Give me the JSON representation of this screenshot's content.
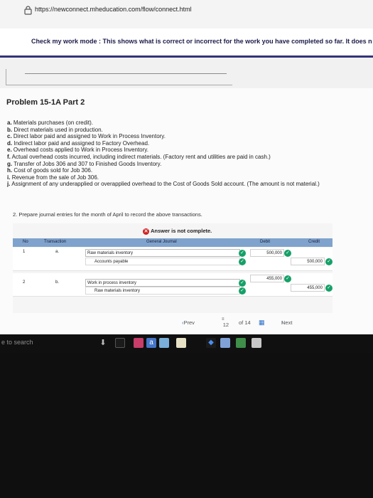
{
  "browser": {
    "url": "https://newconnect.mheducation.com/flow/connect.html"
  },
  "banner": {
    "message": "Check my work mode : This shows what is correct or incorrect for the work you have completed so far. It does n"
  },
  "problem": {
    "title": "Problem 15-1A Part 2",
    "items": [
      {
        "letter": "a.",
        "text": "Materials purchases (on credit)."
      },
      {
        "letter": "b.",
        "text": "Direct materials used in production."
      },
      {
        "letter": "c.",
        "text": "Direct labor paid and assigned to Work in Process Inventory."
      },
      {
        "letter": "d.",
        "text": "Indirect labor paid and assigned to Factory Overhead."
      },
      {
        "letter": "e.",
        "text": "Overhead costs applied to Work in Process Inventory."
      },
      {
        "letter": "f.",
        "text": "Actual overhead costs incurred, including indirect materials. (Factory rent and utilities are paid in cash.)"
      },
      {
        "letter": "g.",
        "text": "Transfer of Jobs 306 and 307 to Finished Goods Inventory."
      },
      {
        "letter": "h.",
        "text": "Cost of goods sold for Job 306."
      },
      {
        "letter": "i.",
        "text": "Revenue from the sale of Job 306."
      },
      {
        "letter": "j.",
        "text": "Assignment of any underapplied or overapplied overhead to the Cost of Goods Sold account. (The amount is not material.)"
      }
    ],
    "prompt": "2. Prepare journal entries for the month of April to record the above transactions."
  },
  "journal": {
    "status": "Answer is not complete.",
    "headers": {
      "no": "No",
      "transaction": "Transaction",
      "general_journal": "General Journal",
      "debit": "Debit",
      "credit": "Credit"
    },
    "entries": [
      {
        "no": "1",
        "transaction": "a.",
        "debit_account": "Raw materials inventory",
        "debit": "500,000",
        "credit_account": "Accounts payable",
        "credit": "500,000"
      },
      {
        "no": "2",
        "transaction": "b.",
        "debit_account": "Work in process inventory",
        "debit": "455,000",
        "credit_account": "Raw materials inventory",
        "credit": "455,000"
      }
    ],
    "pager": {
      "prev": "Prev",
      "current": "12",
      "of": "of 14",
      "next": "Next"
    }
  },
  "taskbar": {
    "search_text": "e to search"
  },
  "colors": {
    "banner_accent": "#33337a",
    "table_header": "#7fa3cc",
    "check_green": "#16a067",
    "error_red": "#d21f1f"
  }
}
